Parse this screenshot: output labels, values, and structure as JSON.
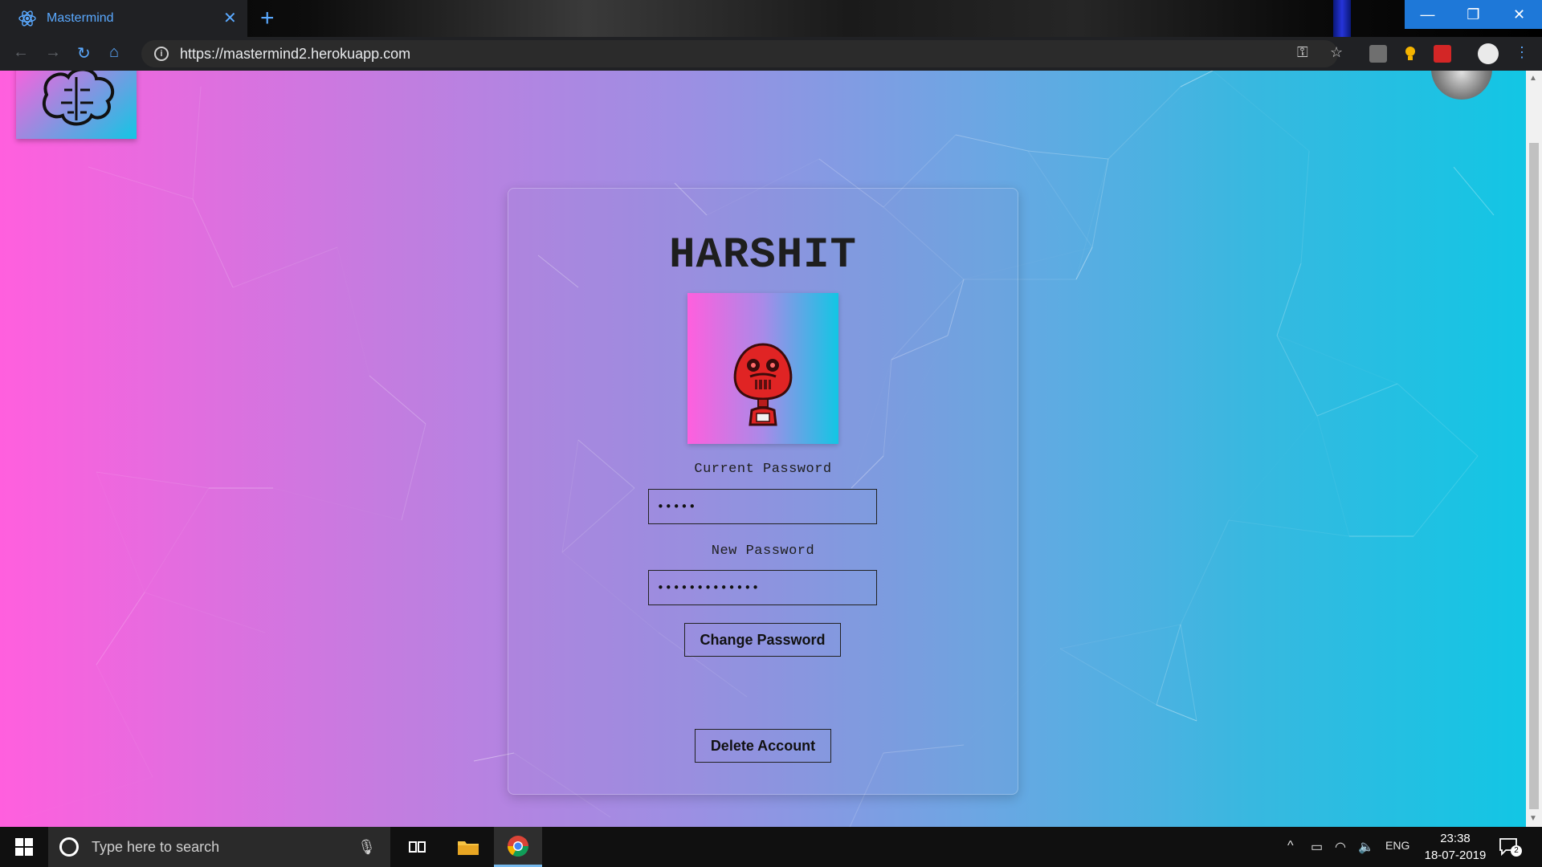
{
  "browser": {
    "tab_title": "Mastermind",
    "tab_close": "✕",
    "new_tab": "+",
    "url": "https://mastermind2.herokuapp.com",
    "window_controls": {
      "minimize": "—",
      "restore": "❐",
      "close": "✕"
    },
    "nav": {
      "back": "←",
      "forward": "→",
      "reload": "↻",
      "home": "⌂"
    },
    "info_icon": "i",
    "key_icon": "⚿",
    "star_icon": "☆",
    "menu_icon": "⋮"
  },
  "page": {
    "username": "HARSHIT",
    "current_password_label": "Current Password",
    "current_password_value": "•••••",
    "new_password_label": "New Password",
    "new_password_value": "•••••••••••••",
    "change_password_button": "Change Password",
    "delete_account_button": "Delete Account"
  },
  "colors": {
    "gradient_left": "#ff5fde",
    "gradient_right": "#12c6e4",
    "robot_red": "#e02424"
  },
  "taskbar": {
    "search_placeholder": "Type here to search",
    "language": "ENG",
    "time": "23:38",
    "date": "18-07-2019",
    "notification_count": "2"
  }
}
